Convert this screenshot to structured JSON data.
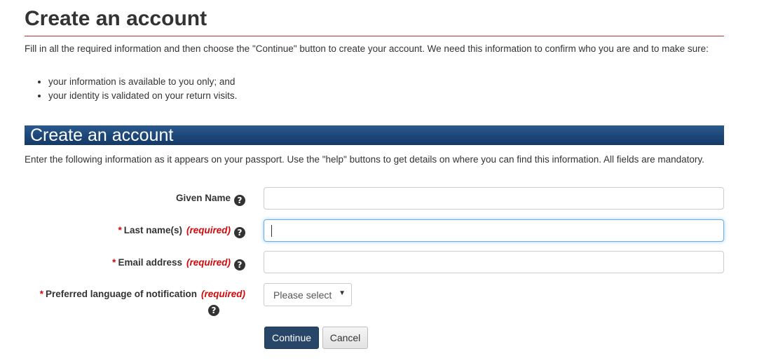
{
  "page": {
    "title": "Create an account",
    "intro": "Fill in all the required information and then choose the \"Continue\" button to create your account. We need this information to confirm who you are and to make sure:",
    "bullets": [
      "your information is available to you only; and",
      "your identity is validated on your return visits."
    ]
  },
  "section": {
    "heading": "Create an account",
    "intro": "Enter the following information as it appears on your passport. Use the \"help\" buttons to get details on where you can find this information. All fields are mandatory."
  },
  "form": {
    "required_marker": "*",
    "required_text": "(required)",
    "help_glyph": "?",
    "fields": [
      {
        "label": "Given Name",
        "required": false,
        "value": ""
      },
      {
        "label": "Last name(s)",
        "required": true,
        "value": "",
        "focused": true
      },
      {
        "label": "Email address",
        "required": true,
        "value": ""
      },
      {
        "label": "Preferred language of notification",
        "required": true,
        "selected": "Please select"
      }
    ]
  },
  "buttons": {
    "continue": "Continue",
    "cancel": "Cancel"
  },
  "colors": {
    "rule": "#b7372f",
    "section_bar": "#1d4678",
    "required": "#d3080c",
    "primary_button": "#284768",
    "focus_border": "#66afe9"
  },
  "icons": {
    "help": "question-circle-icon",
    "select_arrow": "caret-down-icon"
  }
}
